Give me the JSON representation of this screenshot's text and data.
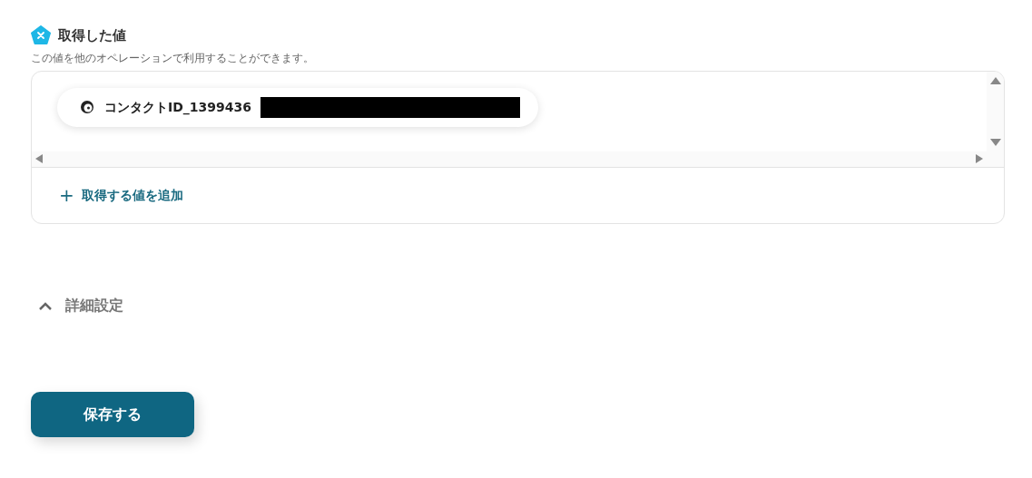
{
  "section": {
    "title": "取得した値",
    "description": "この値を他のオペレーションで利用することができます。"
  },
  "values": [
    {
      "label": "コンタクトID_1399436",
      "redacted": true
    }
  ],
  "add_button": {
    "icon": "+",
    "label": "取得する値を追加"
  },
  "details": {
    "label": "詳細設定",
    "expanded": true
  },
  "save_button": {
    "label": "保存する"
  }
}
